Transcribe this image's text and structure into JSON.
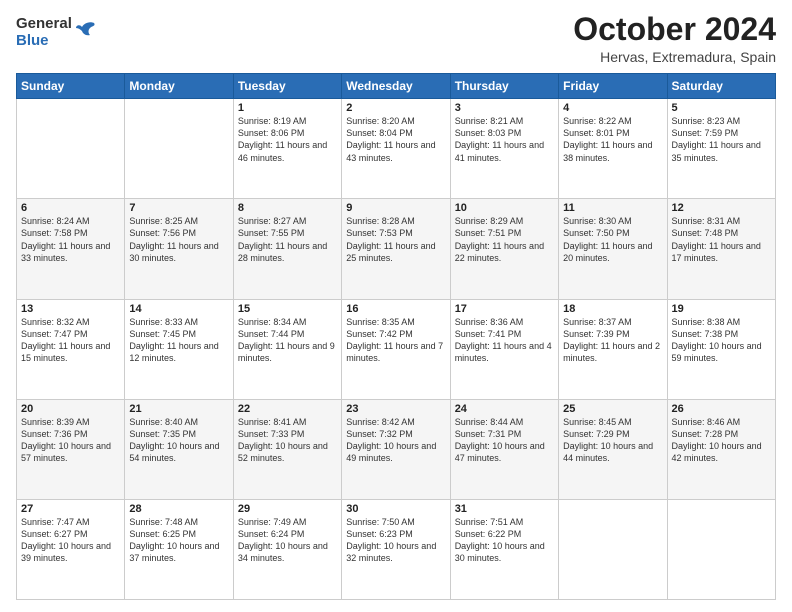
{
  "logo": {
    "general": "General",
    "blue": "Blue"
  },
  "title": "October 2024",
  "location": "Hervas, Extremadura, Spain",
  "days_header": [
    "Sunday",
    "Monday",
    "Tuesday",
    "Wednesday",
    "Thursday",
    "Friday",
    "Saturday"
  ],
  "weeks": [
    [
      {
        "day": "",
        "sunrise": "",
        "sunset": "",
        "daylight": ""
      },
      {
        "day": "",
        "sunrise": "",
        "sunset": "",
        "daylight": ""
      },
      {
        "day": "1",
        "sunrise": "Sunrise: 8:19 AM",
        "sunset": "Sunset: 8:06 PM",
        "daylight": "Daylight: 11 hours and 46 minutes."
      },
      {
        "day": "2",
        "sunrise": "Sunrise: 8:20 AM",
        "sunset": "Sunset: 8:04 PM",
        "daylight": "Daylight: 11 hours and 43 minutes."
      },
      {
        "day": "3",
        "sunrise": "Sunrise: 8:21 AM",
        "sunset": "Sunset: 8:03 PM",
        "daylight": "Daylight: 11 hours and 41 minutes."
      },
      {
        "day": "4",
        "sunrise": "Sunrise: 8:22 AM",
        "sunset": "Sunset: 8:01 PM",
        "daylight": "Daylight: 11 hours and 38 minutes."
      },
      {
        "day": "5",
        "sunrise": "Sunrise: 8:23 AM",
        "sunset": "Sunset: 7:59 PM",
        "daylight": "Daylight: 11 hours and 35 minutes."
      }
    ],
    [
      {
        "day": "6",
        "sunrise": "Sunrise: 8:24 AM",
        "sunset": "Sunset: 7:58 PM",
        "daylight": "Daylight: 11 hours and 33 minutes."
      },
      {
        "day": "7",
        "sunrise": "Sunrise: 8:25 AM",
        "sunset": "Sunset: 7:56 PM",
        "daylight": "Daylight: 11 hours and 30 minutes."
      },
      {
        "day": "8",
        "sunrise": "Sunrise: 8:27 AM",
        "sunset": "Sunset: 7:55 PM",
        "daylight": "Daylight: 11 hours and 28 minutes."
      },
      {
        "day": "9",
        "sunrise": "Sunrise: 8:28 AM",
        "sunset": "Sunset: 7:53 PM",
        "daylight": "Daylight: 11 hours and 25 minutes."
      },
      {
        "day": "10",
        "sunrise": "Sunrise: 8:29 AM",
        "sunset": "Sunset: 7:51 PM",
        "daylight": "Daylight: 11 hours and 22 minutes."
      },
      {
        "day": "11",
        "sunrise": "Sunrise: 8:30 AM",
        "sunset": "Sunset: 7:50 PM",
        "daylight": "Daylight: 11 hours and 20 minutes."
      },
      {
        "day": "12",
        "sunrise": "Sunrise: 8:31 AM",
        "sunset": "Sunset: 7:48 PM",
        "daylight": "Daylight: 11 hours and 17 minutes."
      }
    ],
    [
      {
        "day": "13",
        "sunrise": "Sunrise: 8:32 AM",
        "sunset": "Sunset: 7:47 PM",
        "daylight": "Daylight: 11 hours and 15 minutes."
      },
      {
        "day": "14",
        "sunrise": "Sunrise: 8:33 AM",
        "sunset": "Sunset: 7:45 PM",
        "daylight": "Daylight: 11 hours and 12 minutes."
      },
      {
        "day": "15",
        "sunrise": "Sunrise: 8:34 AM",
        "sunset": "Sunset: 7:44 PM",
        "daylight": "Daylight: 11 hours and 9 minutes."
      },
      {
        "day": "16",
        "sunrise": "Sunrise: 8:35 AM",
        "sunset": "Sunset: 7:42 PM",
        "daylight": "Daylight: 11 hours and 7 minutes."
      },
      {
        "day": "17",
        "sunrise": "Sunrise: 8:36 AM",
        "sunset": "Sunset: 7:41 PM",
        "daylight": "Daylight: 11 hours and 4 minutes."
      },
      {
        "day": "18",
        "sunrise": "Sunrise: 8:37 AM",
        "sunset": "Sunset: 7:39 PM",
        "daylight": "Daylight: 11 hours and 2 minutes."
      },
      {
        "day": "19",
        "sunrise": "Sunrise: 8:38 AM",
        "sunset": "Sunset: 7:38 PM",
        "daylight": "Daylight: 10 hours and 59 minutes."
      }
    ],
    [
      {
        "day": "20",
        "sunrise": "Sunrise: 8:39 AM",
        "sunset": "Sunset: 7:36 PM",
        "daylight": "Daylight: 10 hours and 57 minutes."
      },
      {
        "day": "21",
        "sunrise": "Sunrise: 8:40 AM",
        "sunset": "Sunset: 7:35 PM",
        "daylight": "Daylight: 10 hours and 54 minutes."
      },
      {
        "day": "22",
        "sunrise": "Sunrise: 8:41 AM",
        "sunset": "Sunset: 7:33 PM",
        "daylight": "Daylight: 10 hours and 52 minutes."
      },
      {
        "day": "23",
        "sunrise": "Sunrise: 8:42 AM",
        "sunset": "Sunset: 7:32 PM",
        "daylight": "Daylight: 10 hours and 49 minutes."
      },
      {
        "day": "24",
        "sunrise": "Sunrise: 8:44 AM",
        "sunset": "Sunset: 7:31 PM",
        "daylight": "Daylight: 10 hours and 47 minutes."
      },
      {
        "day": "25",
        "sunrise": "Sunrise: 8:45 AM",
        "sunset": "Sunset: 7:29 PM",
        "daylight": "Daylight: 10 hours and 44 minutes."
      },
      {
        "day": "26",
        "sunrise": "Sunrise: 8:46 AM",
        "sunset": "Sunset: 7:28 PM",
        "daylight": "Daylight: 10 hours and 42 minutes."
      }
    ],
    [
      {
        "day": "27",
        "sunrise": "Sunrise: 7:47 AM",
        "sunset": "Sunset: 6:27 PM",
        "daylight": "Daylight: 10 hours and 39 minutes."
      },
      {
        "day": "28",
        "sunrise": "Sunrise: 7:48 AM",
        "sunset": "Sunset: 6:25 PM",
        "daylight": "Daylight: 10 hours and 37 minutes."
      },
      {
        "day": "29",
        "sunrise": "Sunrise: 7:49 AM",
        "sunset": "Sunset: 6:24 PM",
        "daylight": "Daylight: 10 hours and 34 minutes."
      },
      {
        "day": "30",
        "sunrise": "Sunrise: 7:50 AM",
        "sunset": "Sunset: 6:23 PM",
        "daylight": "Daylight: 10 hours and 32 minutes."
      },
      {
        "day": "31",
        "sunrise": "Sunrise: 7:51 AM",
        "sunset": "Sunset: 6:22 PM",
        "daylight": "Daylight: 10 hours and 30 minutes."
      },
      {
        "day": "",
        "sunrise": "",
        "sunset": "",
        "daylight": ""
      },
      {
        "day": "",
        "sunrise": "",
        "sunset": "",
        "daylight": ""
      }
    ]
  ]
}
